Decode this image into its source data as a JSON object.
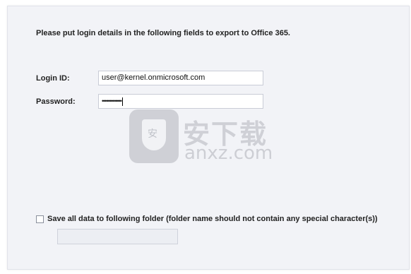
{
  "form": {
    "instruction": "Please put login details in the following fields to export to Office 365.",
    "login_label": "Login ID:",
    "login_value": "user@kernel.onmicrosoft.com",
    "password_label": "Password:",
    "password_mask": "•••••••••••••",
    "save_checkbox_checked": false,
    "save_label": "Save all data to following folder (folder name should not contain any special character(s))",
    "folder_value": ""
  },
  "watermark": {
    "cn_text": "安下载",
    "en_text": "anxz.com",
    "logo_glyph": "安"
  }
}
